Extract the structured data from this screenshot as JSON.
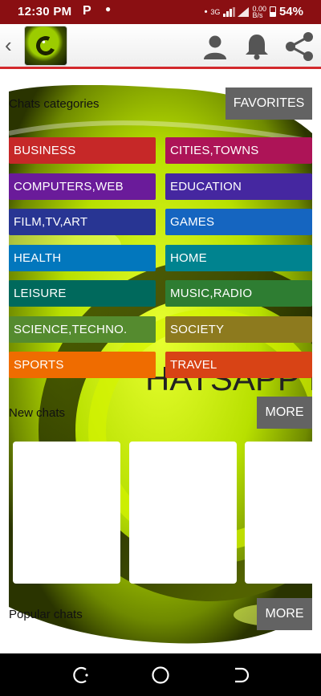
{
  "status_bar": {
    "time": "12:30 PM",
    "app_indicator": "P",
    "network_label": "3G",
    "data_rate": "0.00",
    "data_unit": "B/s",
    "battery": "54%"
  },
  "app_bar": {
    "back_icon": "chevron-left-icon",
    "actions": [
      "profile-icon",
      "bell-icon",
      "share-icon"
    ]
  },
  "categories": {
    "title": "Chats categories",
    "favorites_label": "FAVORITES",
    "items": [
      {
        "label": "BUSINESS",
        "color": "#c62828"
      },
      {
        "label": "CITIES,TOWNS",
        "color": "#ad1457"
      },
      {
        "label": "COMPUTERS,WEB",
        "color": "#6a1b9a"
      },
      {
        "label": "EDUCATION",
        "color": "#4527a0"
      },
      {
        "label": "FILM,TV,ART",
        "color": "#283593"
      },
      {
        "label": "GAMES",
        "color": "#1565c0"
      },
      {
        "label": "HEALTH",
        "color": "#0277bd"
      },
      {
        "label": "HOME",
        "color": "#00838f"
      },
      {
        "label": "LEISURE",
        "color": "#00695c"
      },
      {
        "label": "MUSIC,RADIO",
        "color": "#2e7d32"
      },
      {
        "label": "SCIENCE,TECHNO.",
        "color": "#558b2f"
      },
      {
        "label": "SOCIETY",
        "color": "#8d7a1e"
      },
      {
        "label": "SPORTS",
        "color": "#ef6c00"
      },
      {
        "label": "TRAVEL",
        "color": "#d84315"
      }
    ]
  },
  "new_chats": {
    "title": "New chats",
    "more_label": "MORE"
  },
  "popular_chats": {
    "title": "Popular chats",
    "more_label": "MORE"
  },
  "background_text": "HATSAPP N"
}
